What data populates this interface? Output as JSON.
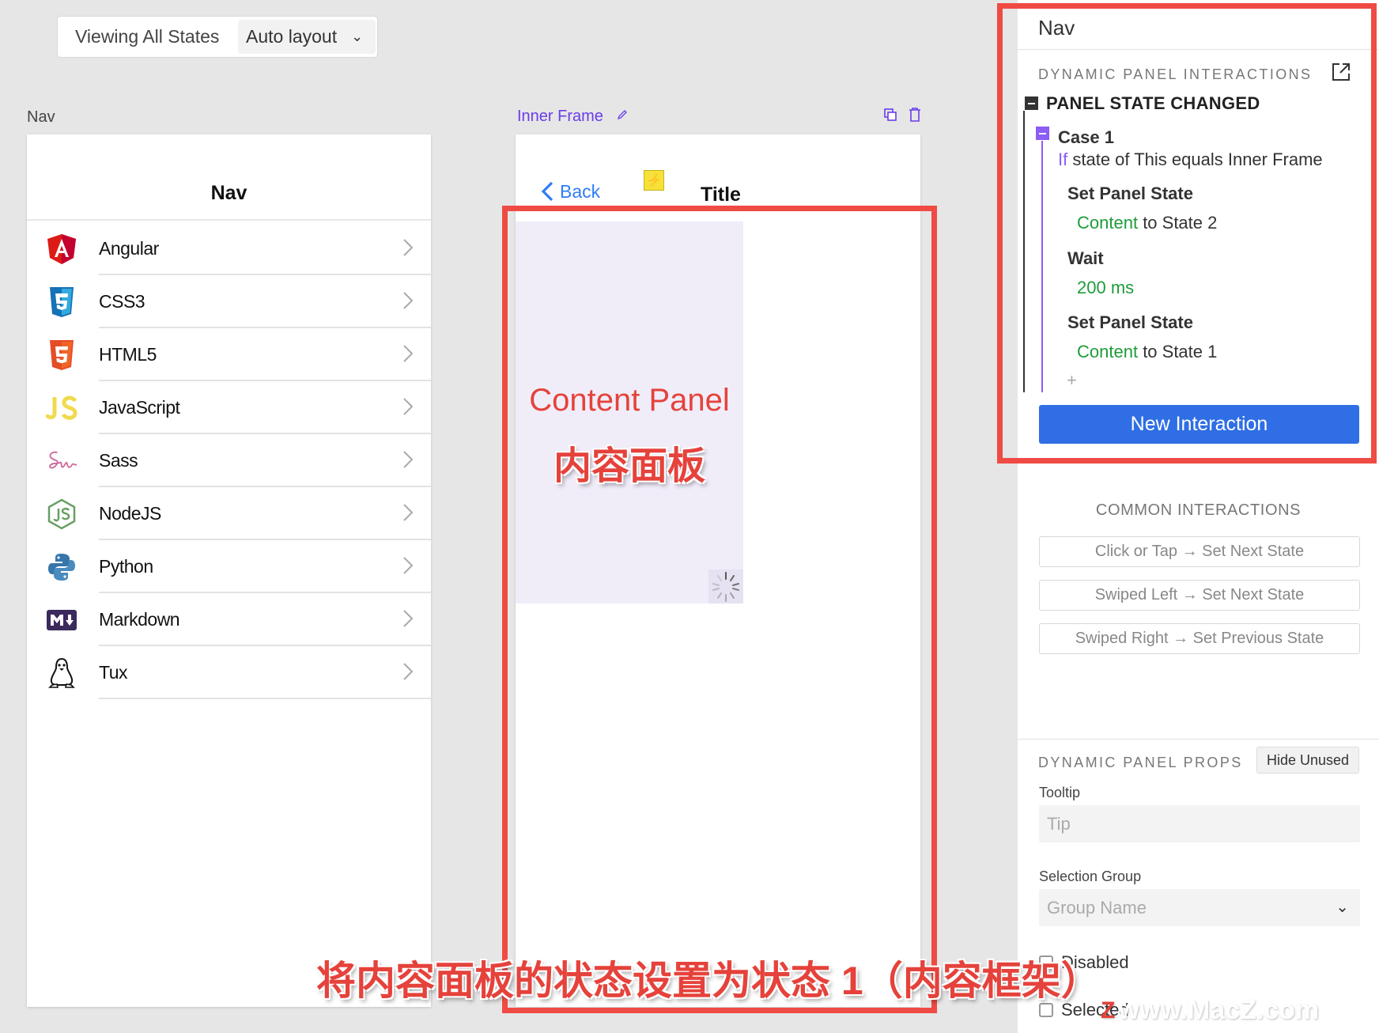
{
  "toolbar": {
    "viewing_label": "Viewing All States",
    "layout_select": "Auto layout"
  },
  "canvas": {
    "nav_label": "Nav",
    "inner_frame_label": "Inner Frame"
  },
  "nav_screen": {
    "title": "Nav",
    "items": [
      {
        "label": "Angular",
        "icon": "angular-icon"
      },
      {
        "label": "CSS3",
        "icon": "css3-icon"
      },
      {
        "label": "HTML5",
        "icon": "html5-icon"
      },
      {
        "label": "JavaScript",
        "icon": "javascript-icon"
      },
      {
        "label": "Sass",
        "icon": "sass-icon"
      },
      {
        "label": "NodeJS",
        "icon": "nodejs-icon"
      },
      {
        "label": "Python",
        "icon": "python-icon"
      },
      {
        "label": "Markdown",
        "icon": "markdown-icon"
      },
      {
        "label": "Tux",
        "icon": "tux-icon"
      }
    ]
  },
  "inner_frame": {
    "back_label": "Back",
    "title": "Title",
    "content_label": "Content Panel",
    "content_label_cn": "内容面板"
  },
  "panel": {
    "title": "Nav",
    "interactions_header": "DYNAMIC PANEL INTERACTIONS",
    "event": "PANEL STATE CHANGED",
    "case_title": "Case 1",
    "condition_if": "If",
    "condition_text": "state of This equals Inner Frame",
    "actions": [
      {
        "title": "Set Panel State",
        "target": "Content",
        "detail": "to State 2"
      },
      {
        "title": "Wait",
        "target": "200 ms",
        "detail": ""
      },
      {
        "title": "Set Panel State",
        "target": "Content",
        "detail": "to State 1"
      }
    ],
    "add_symbol": "+",
    "new_interaction": "New Interaction",
    "common_header": "COMMON INTERACTIONS",
    "common": [
      "Click or Tap → Set Next State",
      "Swiped Left → Set Next State",
      "Swiped Right → Set Previous State"
    ],
    "props_header": "DYNAMIC PANEL PROPS",
    "hide_unused": "Hide Unused",
    "tooltip_label": "Tooltip",
    "tooltip_placeholder": "Tip",
    "selection_group_label": "Selection Group",
    "group_placeholder": "Group Name",
    "disabled_label": "Disabled",
    "selected_label": "Selected"
  },
  "overlay": {
    "caption": "将内容面板的状态设置为状态 1（内容框架）",
    "watermark": "www.MacZ.com",
    "watermark_logo": "Z"
  },
  "colors": {
    "accent_blue": "#2f6ee5",
    "annotation_red": "#ef4b44",
    "green": "#1e9c3a",
    "purple": "#8b5cf6"
  }
}
